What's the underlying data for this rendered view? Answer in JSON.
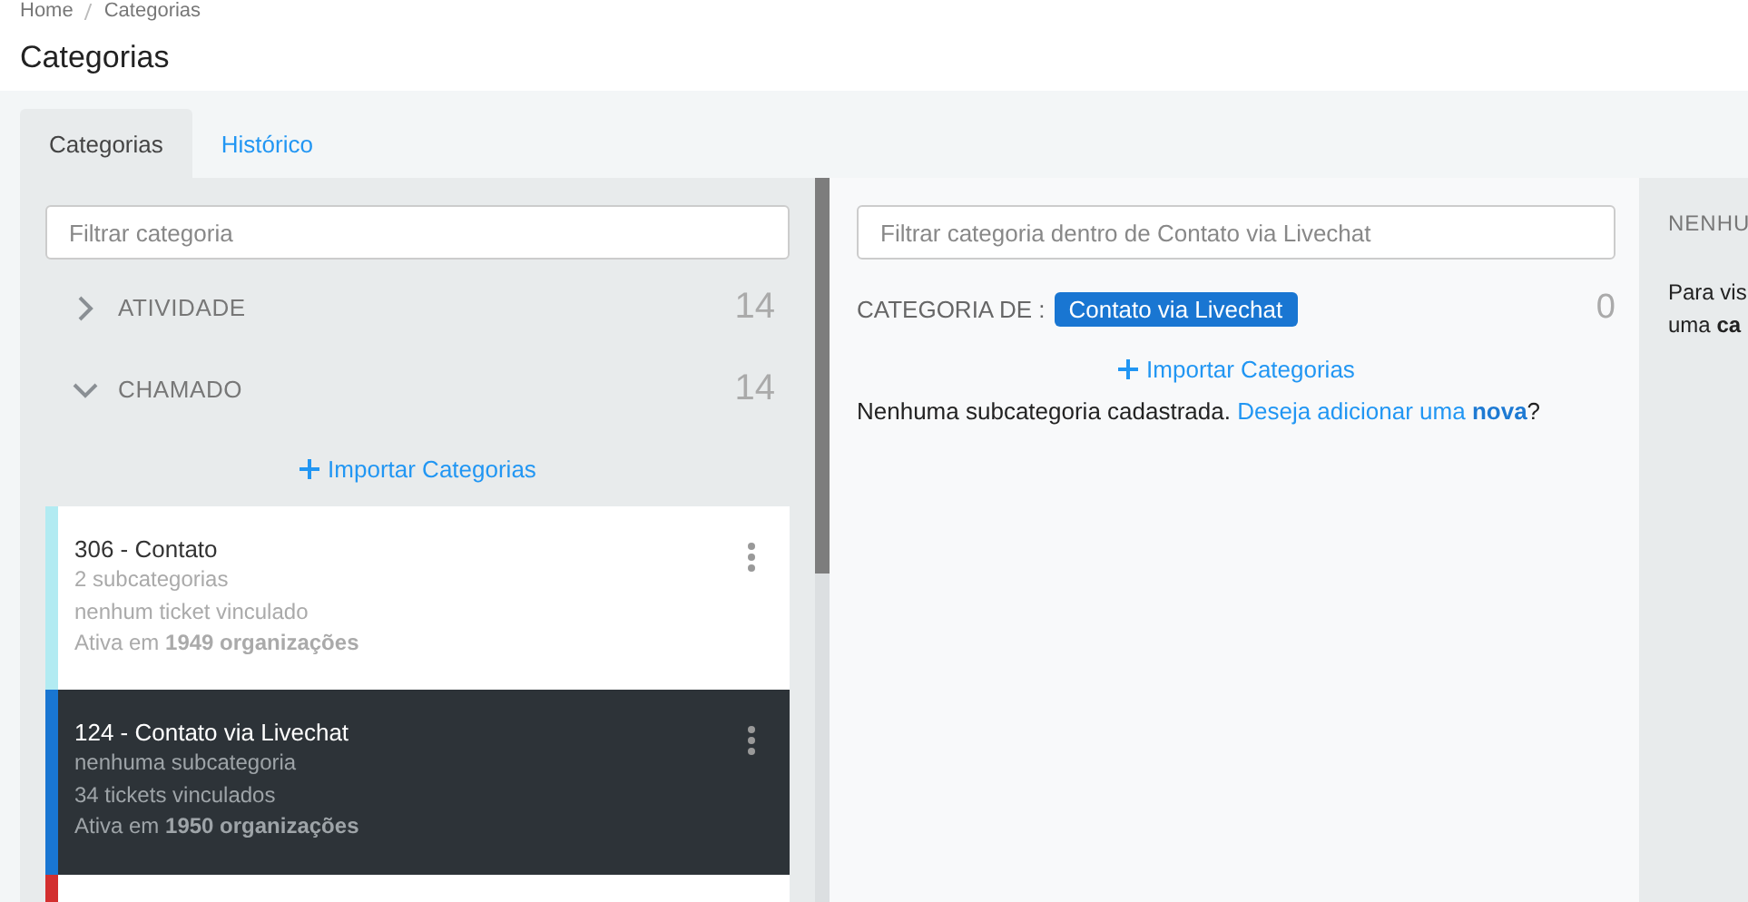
{
  "breadcrumb": [
    "Home",
    "Categorias"
  ],
  "page_title": "Categorias",
  "tabs": [
    {
      "label": "Categorias",
      "selected": true
    },
    {
      "label": "Histórico",
      "selected": false
    }
  ],
  "left_panel": {
    "filter": {
      "placeholder": "Filtrar categoria"
    },
    "groups": [
      {
        "label": "ATIVIDADE",
        "count": "14",
        "expanded": false
      },
      {
        "label": "CHAMADO",
        "count": "14",
        "expanded": true
      }
    ],
    "import_link": "Importar Categorias",
    "cards": [
      {
        "title": "306 - Contato",
        "lines": [
          "2 subcategorias",
          "nenhum ticket vinculado",
          "Ativa em **1949 organizações**"
        ],
        "color": "#b2ebf2",
        "selected": false
      },
      {
        "title": "124 - Contato via Livechat",
        "lines": [
          "nenhuma subcategoria",
          "34 tickets vinculados",
          "Ativa em **1950 organizações**"
        ],
        "color": "#1976d2",
        "selected": true
      },
      {
        "color": "#d32f2f",
        "selected": false
      }
    ]
  },
  "middle_panel": {
    "filter": {
      "placeholder": "Filtrar categoria dentro de Contato via Livechat"
    },
    "category_label": "CATEGORIA DE :",
    "category_tag": "Contato via Livechat",
    "count": "0",
    "import_link": "Importar Categorias",
    "empty_text": "Nenhuma subcategoria cadastrada.",
    "empty_link": "Deseja adicionar uma **nova**",
    "empty_end": "?"
  },
  "right_panel": {
    "heading": "NENHU",
    "lines": [
      "Para vis",
      "uma **ca**"
    ]
  }
}
